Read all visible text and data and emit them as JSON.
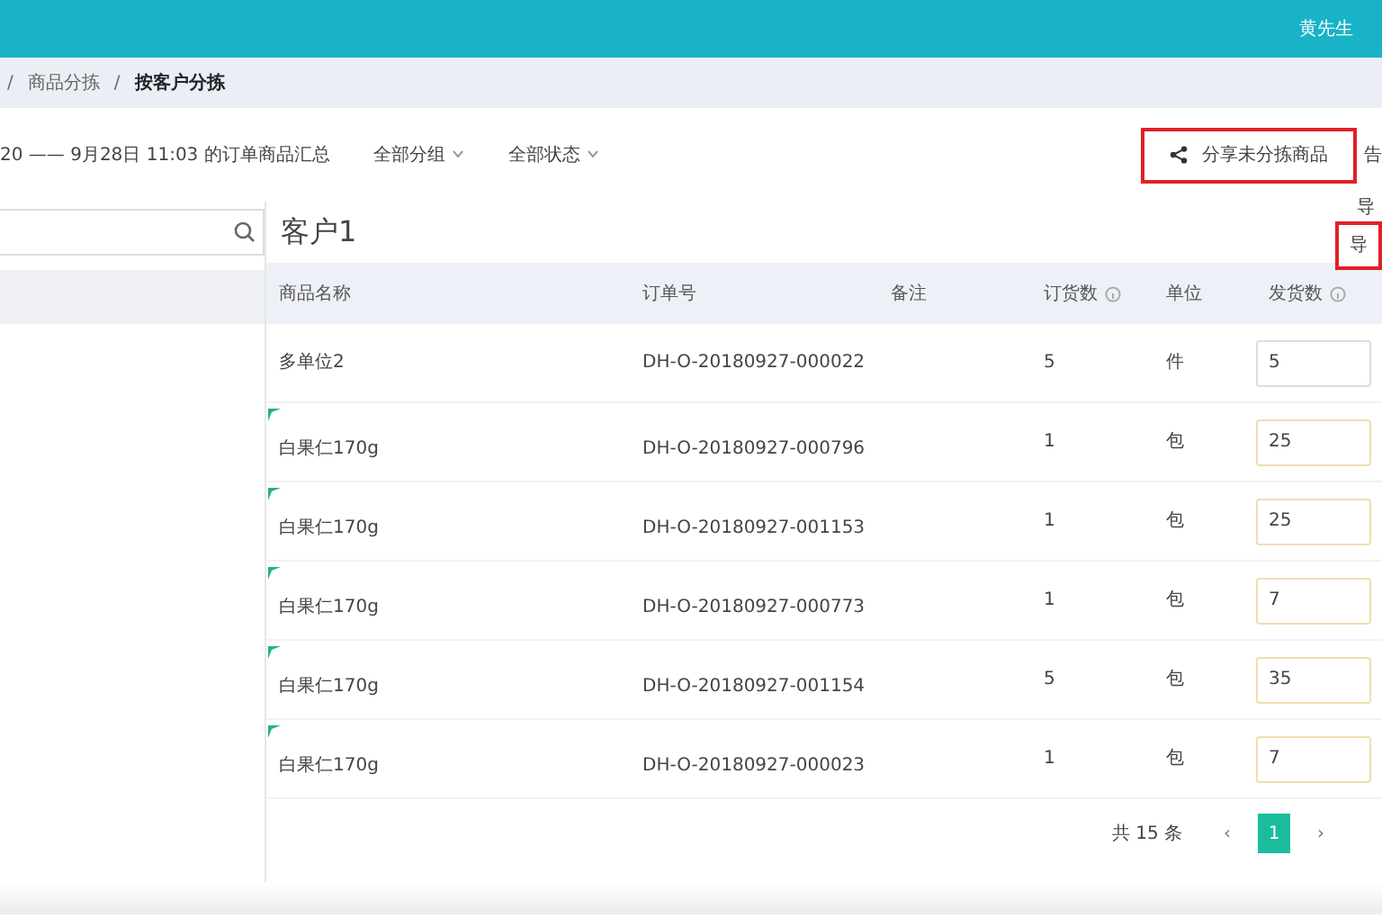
{
  "header": {
    "user": "黄先生"
  },
  "breadcrumb": [
    "/",
    "商品分拣",
    "/",
    "按客户分拣"
  ],
  "toolbar": {
    "summary": "20 —— 9月28日 11:03 的订单商品汇总",
    "filters": [
      "全部分组",
      "全部状态"
    ],
    "share_button": "分享未分拣商品",
    "edge_text": "告"
  },
  "side_texts": [
    "导",
    "导"
  ],
  "customer": "客户1",
  "table": {
    "columns": [
      {
        "label": "商品名称",
        "info": false
      },
      {
        "label": "订单号",
        "info": false
      },
      {
        "label": "备注",
        "info": false
      },
      {
        "label": "订货数",
        "info": true
      },
      {
        "label": "单位",
        "info": false
      },
      {
        "label": "发货数",
        "info": true
      }
    ],
    "rows": [
      {
        "name": "多单位2",
        "order": "DH-O-20180927-000022",
        "qty": "5",
        "unit": "件",
        "ship": "5",
        "flagged": false
      },
      {
        "name": "白果仁170g",
        "order": "DH-O-20180927-000796",
        "qty": "1",
        "unit": "包",
        "ship": "25",
        "flagged": true
      },
      {
        "name": "白果仁170g",
        "order": "DH-O-20180927-001153",
        "qty": "1",
        "unit": "包",
        "ship": "25",
        "flagged": true
      },
      {
        "name": "白果仁170g",
        "order": "DH-O-20180927-000773",
        "qty": "1",
        "unit": "包",
        "ship": "7",
        "flagged": true
      },
      {
        "name": "白果仁170g",
        "order": "DH-O-20180927-001154",
        "qty": "5",
        "unit": "包",
        "ship": "35",
        "flagged": true
      },
      {
        "name": "白果仁170g",
        "order": "DH-O-20180927-000023",
        "qty": "1",
        "unit": "包",
        "ship": "7",
        "flagged": true
      }
    ]
  },
  "pagination": {
    "total": "共 15 条",
    "prev": "‹",
    "pages": [
      {
        "label": "1",
        "selected": true
      }
    ],
    "next": "›"
  }
}
